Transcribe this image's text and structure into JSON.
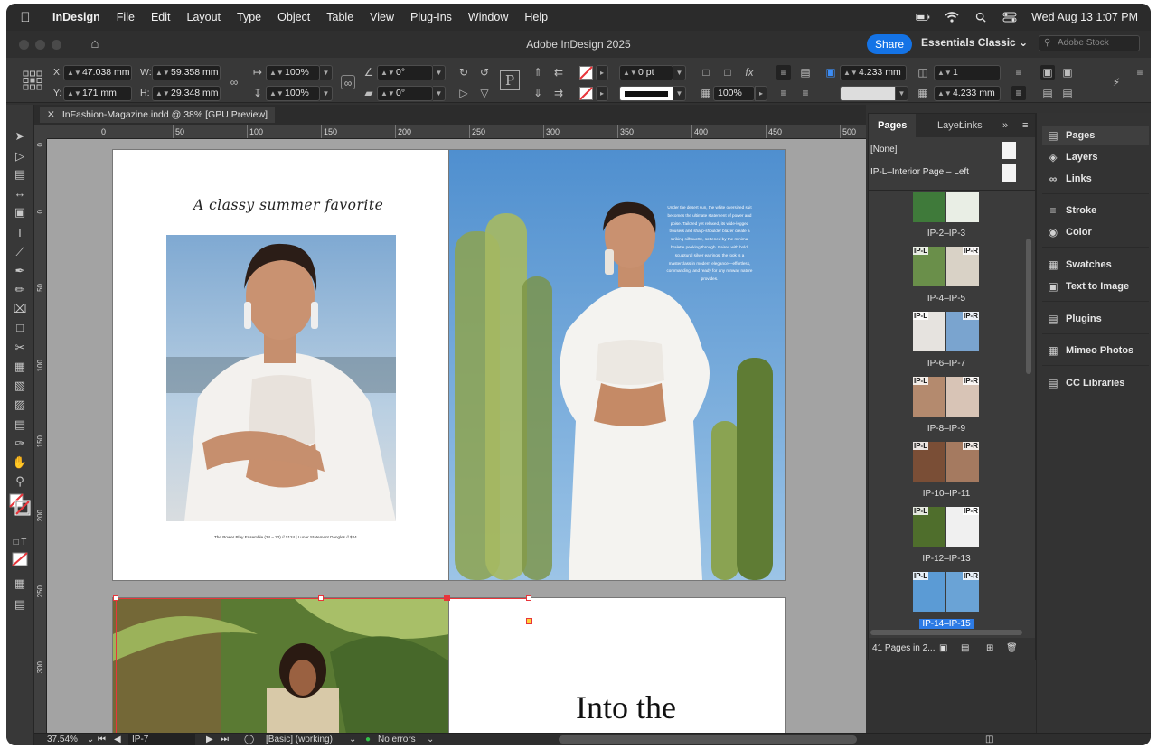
{
  "menubar": {
    "app_name": "InDesign",
    "items": [
      "File",
      "Edit",
      "Layout",
      "Type",
      "Object",
      "Table",
      "View",
      "Plug-Ins",
      "Window",
      "Help"
    ],
    "datetime": "Wed Aug 13  1:07 PM"
  },
  "titlebar": {
    "title": "Adobe InDesign 2025",
    "share_label": "Share",
    "workspace": "Essentials Classic",
    "stock_placeholder": "Adobe Stock"
  },
  "control": {
    "x_label": "X:",
    "x_value": "47.038 mm",
    "y_label": "Y:",
    "y_value": "171 mm",
    "w_label": "W:",
    "w_value": "59.358 mm",
    "h_label": "H:",
    "h_value": "29.348 mm",
    "scale_x": "100%",
    "scale_y": "100%",
    "rotate": "0°",
    "shear": "0°",
    "stroke_weight": "0 pt",
    "opacity": "100%",
    "corner_size": "4.233 mm",
    "columns": "1",
    "gutter": "4.233 mm"
  },
  "document": {
    "tab_label": "InFashion-Magazine.indd @ 38% [GPU Preview]"
  },
  "ruler": {
    "h_ticks": [
      "0",
      "50",
      "100",
      "150",
      "200",
      "250",
      "300",
      "350",
      "400",
      "450",
      "500"
    ],
    "v_ticks": [
      "0",
      "50",
      "100",
      "150",
      "200",
      "250",
      "300"
    ]
  },
  "spread1": {
    "headline": "A classy summer favorite",
    "caption": "The Power Play Ensemble (24 – 32) // $124  |  Lunar Statement Dangles // $24",
    "body": "Under the desert sun, the white oversized suit becomes the ultimate statement of power and poise. Tailored yet relaxed, its wide-legged trousers and sharp-shoulder blazer create a striking silhouette, softened by the minimal bralette peeking through. Paired with bold, sculptural silver earrings, the look is a masterclass in modern elegance—effortless, commanding, and ready for any runway nature provides."
  },
  "spread2": {
    "title": "Into the"
  },
  "pages_panel": {
    "tabs": [
      "Pages",
      "Layer",
      "Links"
    ],
    "masters": [
      "[None]",
      "IP-L–Interior Page – Left"
    ],
    "spreads": [
      {
        "label": "IP-2–IP-3",
        "tags": [
          "",
          ""
        ]
      },
      {
        "label": "IP-4–IP-5",
        "tags": [
          "IP-L",
          "IP-R"
        ]
      },
      {
        "label": "IP-6–IP-7",
        "tags": [
          "IP-L",
          "IP-R"
        ]
      },
      {
        "label": "IP-8–IP-9",
        "tags": [
          "IP-L",
          "IP-R"
        ]
      },
      {
        "label": "IP-10–IP-11",
        "tags": [
          "IP-L",
          "IP-R"
        ]
      },
      {
        "label": "IP-12–IP-13",
        "tags": [
          "IP-L",
          "IP-R"
        ]
      },
      {
        "label": "IP-14–IP-15",
        "tags": [
          "IP-L",
          "IP-R"
        ]
      }
    ],
    "footer": "41 Pages in 2..."
  },
  "dock": {
    "items": [
      "Pages",
      "Layers",
      "Links",
      "Stroke",
      "Color",
      "Swatches",
      "Text to Image",
      "Plugins",
      "Mimeo Photos",
      "CC Libraries"
    ]
  },
  "status": {
    "zoom": "37.54%",
    "page": "IP-7",
    "preflight_profile": "[Basic] (working)",
    "errors": "No errors"
  },
  "colors": {
    "accent": "#1473e6",
    "selection": "#2d7be5",
    "frame_select": "#e8353b",
    "ok": "#35c04a"
  }
}
